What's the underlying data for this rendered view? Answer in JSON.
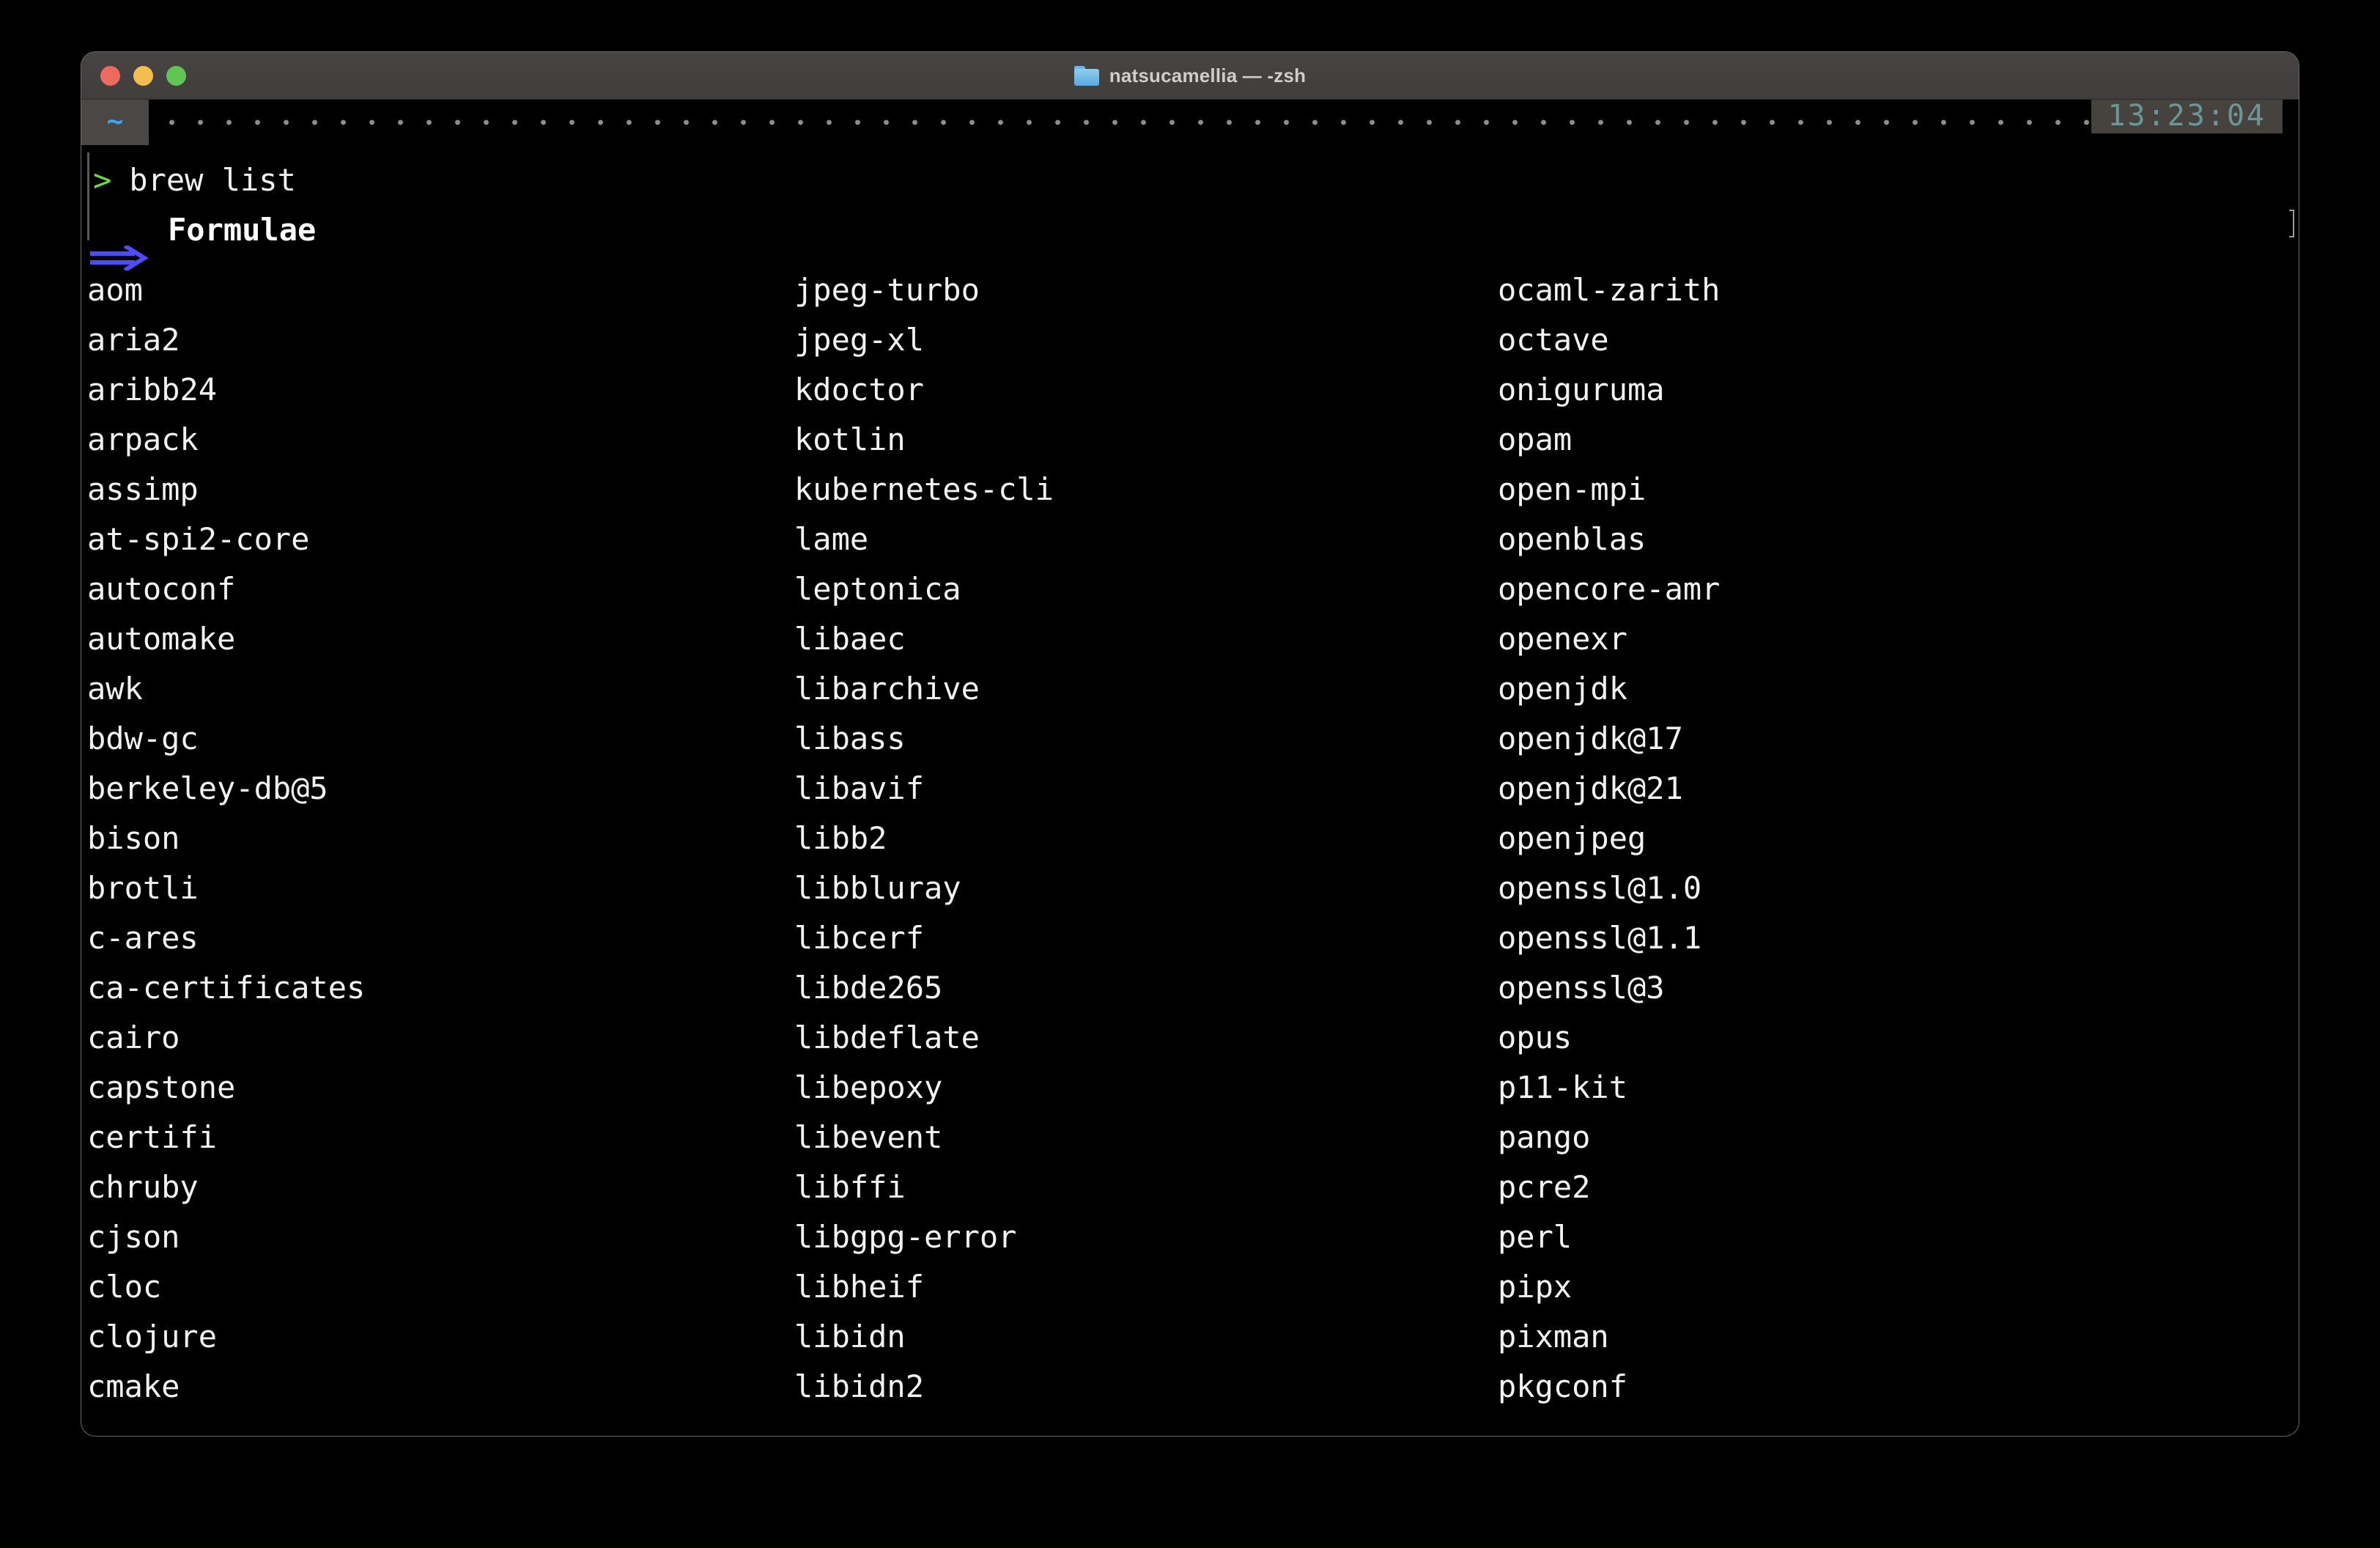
{
  "window": {
    "title": "natsucamellia — -zsh",
    "folder_icon": "folder-icon",
    "traffic_lights": {
      "close": "close-button",
      "minimize": "minimize-button",
      "maximize": "maximize-button"
    },
    "colors": {
      "titlebar_bg": "#474443",
      "terminal_bg": "#000000",
      "text": "#f2f2f2",
      "prompt_green": "#6fdc47",
      "arrow_blue": "#4d4dff",
      "tab_blue": "#3da2f5",
      "clock_text": "#6d9698",
      "clock_bg": "#46433f"
    }
  },
  "tabstrip": {
    "tab_label": "~",
    "clock": "13:23:04"
  },
  "terminal": {
    "prompt_symbol": ">",
    "command": "brew list",
    "section_arrow": "⟹",
    "section_title": "Formulae",
    "columns": [
      [
        "aom",
        "aria2",
        "aribb24",
        "arpack",
        "assimp",
        "at-spi2-core",
        "autoconf",
        "automake",
        "awk",
        "bdw-gc",
        "berkeley-db@5",
        "bison",
        "brotli",
        "c-ares",
        "ca-certificates",
        "cairo",
        "capstone",
        "certifi",
        "chruby",
        "cjson",
        "cloc",
        "clojure",
        "cmake"
      ],
      [
        "jpeg-turbo",
        "jpeg-xl",
        "kdoctor",
        "kotlin",
        "kubernetes-cli",
        "lame",
        "leptonica",
        "libaec",
        "libarchive",
        "libass",
        "libavif",
        "libb2",
        "libbluray",
        "libcerf",
        "libde265",
        "libdeflate",
        "libepoxy",
        "libevent",
        "libffi",
        "libgpg-error",
        "libheif",
        "libidn",
        "libidn2"
      ],
      [
        "ocaml-zarith",
        "octave",
        "oniguruma",
        "opam",
        "open-mpi",
        "openblas",
        "opencore-amr",
        "openexr",
        "openjdk",
        "openjdk@17",
        "openjdk@21",
        "openjpeg",
        "openssl@1.0",
        "openssl@1.1",
        "openssl@3",
        "opus",
        "p11-kit",
        "pango",
        "pcre2",
        "perl",
        "pipx",
        "pixman",
        "pkgconf"
      ]
    ]
  }
}
